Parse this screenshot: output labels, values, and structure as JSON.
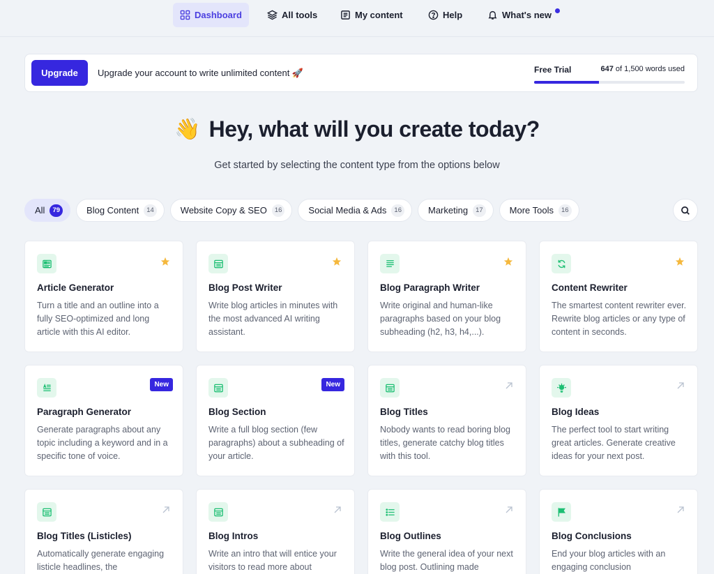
{
  "nav": {
    "items": [
      {
        "label": "Dashboard",
        "icon": "dashboard-icon",
        "active": true
      },
      {
        "label": "All tools",
        "icon": "layers-icon"
      },
      {
        "label": "My content",
        "icon": "document-icon"
      },
      {
        "label": "Help",
        "icon": "help-icon"
      },
      {
        "label": "What's new",
        "icon": "bell-icon"
      }
    ]
  },
  "banner": {
    "button": "Upgrade",
    "text": "Upgrade your account to write unlimited content 🚀",
    "plan": "Free Trial",
    "words_used": "647",
    "words_rest": "of 1,500 words used",
    "progress": 0.43
  },
  "hero": {
    "emoji": "👋",
    "title": "Hey, what will you create today?",
    "subtitle": "Get started by selecting the content type from the options below"
  },
  "filters": [
    {
      "label": "All",
      "count": "79",
      "active": true
    },
    {
      "label": "Blog Content",
      "count": "14"
    },
    {
      "label": "Website Copy & SEO",
      "count": "16"
    },
    {
      "label": "Social Media & Ads",
      "count": "16"
    },
    {
      "label": "Marketing",
      "count": "17"
    },
    {
      "label": "More Tools",
      "count": "16"
    }
  ],
  "cards": [
    {
      "title": "Article Generator",
      "desc": "Turn a title and an outline into a fully SEO-optimized and long article with this AI editor.",
      "corner": "star",
      "icon": "article-icon"
    },
    {
      "title": "Blog Post Writer",
      "desc": "Write blog articles in minutes with the most advanced AI writing assistant.",
      "corner": "star",
      "icon": "blog-icon"
    },
    {
      "title": "Blog Paragraph Writer",
      "desc": "Write original and human-like paragraphs based on your blog subheading (h2, h3, h4,...).",
      "corner": "star",
      "icon": "lines-icon"
    },
    {
      "title": "Content Rewriter",
      "desc": "The smartest content rewriter ever. Rewrite blog articles or any type of content in seconds.",
      "corner": "star",
      "icon": "refresh-icon"
    },
    {
      "title": "Paragraph Generator",
      "desc": "Generate paragraphs about any topic including a keyword and in a specific tone of voice.",
      "corner": "new",
      "badge": "New",
      "icon": "paragraph-icon"
    },
    {
      "title": "Blog Section",
      "desc": "Write a full blog section (few paragraphs) about a subheading of your article.",
      "corner": "new",
      "badge": "New",
      "icon": "blog-icon"
    },
    {
      "title": "Blog Titles",
      "desc": "Nobody wants to read boring blog titles, generate catchy blog titles with this tool.",
      "corner": "arrow",
      "icon": "blog-icon"
    },
    {
      "title": "Blog Ideas",
      "desc": "The perfect tool to start writing great articles. Generate creative ideas for your next post.",
      "corner": "arrow",
      "icon": "bulb-icon"
    },
    {
      "title": "Blog Titles (Listicles)",
      "desc": "Automatically generate engaging listicle headlines, the",
      "corner": "arrow",
      "icon": "blog-icon"
    },
    {
      "title": "Blog Intros",
      "desc": "Write an intro that will entice your visitors to read more about",
      "corner": "arrow",
      "icon": "blog-icon"
    },
    {
      "title": "Blog Outlines",
      "desc": "Write the general idea of your next blog post. Outlining made",
      "corner": "arrow",
      "icon": "list-icon"
    },
    {
      "title": "Blog Conclusions",
      "desc": "End your blog articles with an engaging conclusion",
      "corner": "arrow",
      "icon": "flag-icon"
    }
  ],
  "colors": {
    "accent": "#3627df",
    "card_icon_bg": "#e3f7ec",
    "card_icon": "#1dbf73",
    "star": "#f5b83d"
  }
}
